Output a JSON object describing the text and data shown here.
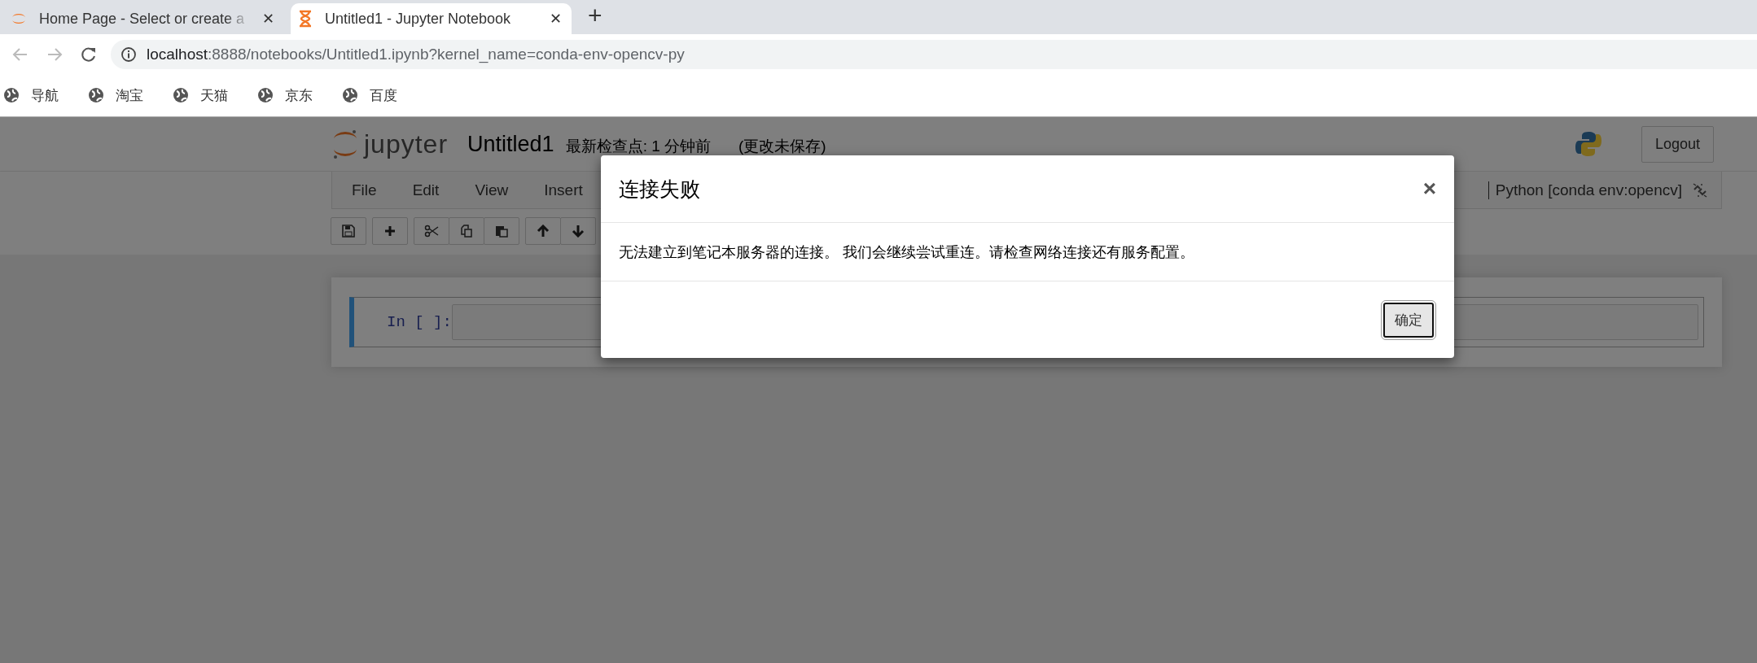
{
  "browser": {
    "tabs": [
      {
        "title": "Home Page - Select or create a",
        "close": "✕",
        "selected": false
      },
      {
        "title": "Untitled1 - Jupyter Notebook",
        "close": "✕",
        "selected": true
      }
    ],
    "new_tab": "+",
    "url": {
      "host": "localhost",
      "path": ":8888/notebooks/Untitled1.ipynb?kernel_name=conda-env-opencv-py"
    },
    "bookmarks": [
      "导航",
      "淘宝",
      "天猫",
      "京东",
      "百度"
    ]
  },
  "notebook": {
    "logo_text": "jupyter",
    "name": "Untitled1",
    "checkpoint": "最新检查点: 1 分钟前",
    "save_status": "(更改未保存)",
    "logout": "Logout",
    "menu": [
      "File",
      "Edit",
      "View",
      "Insert"
    ],
    "kernel": "Python [conda env:opencv]",
    "toolbar": [
      [
        {
          "kind": "save"
        }
      ],
      [
        {
          "kind": "add"
        }
      ],
      [
        {
          "kind": "cut"
        },
        {
          "kind": "copy"
        },
        {
          "kind": "paste"
        }
      ],
      [
        {
          "kind": "up"
        },
        {
          "kind": "down"
        }
      ]
    ],
    "cells": [
      {
        "prompt": "In [ ]:",
        "selected": true
      }
    ]
  },
  "dialog": {
    "title": "连接失败",
    "close": "×",
    "message": "无法建立到笔记本服务器的连接。 我们会继续尝试重连。请检查网络连接还有服务配置。",
    "button": "确定"
  }
}
